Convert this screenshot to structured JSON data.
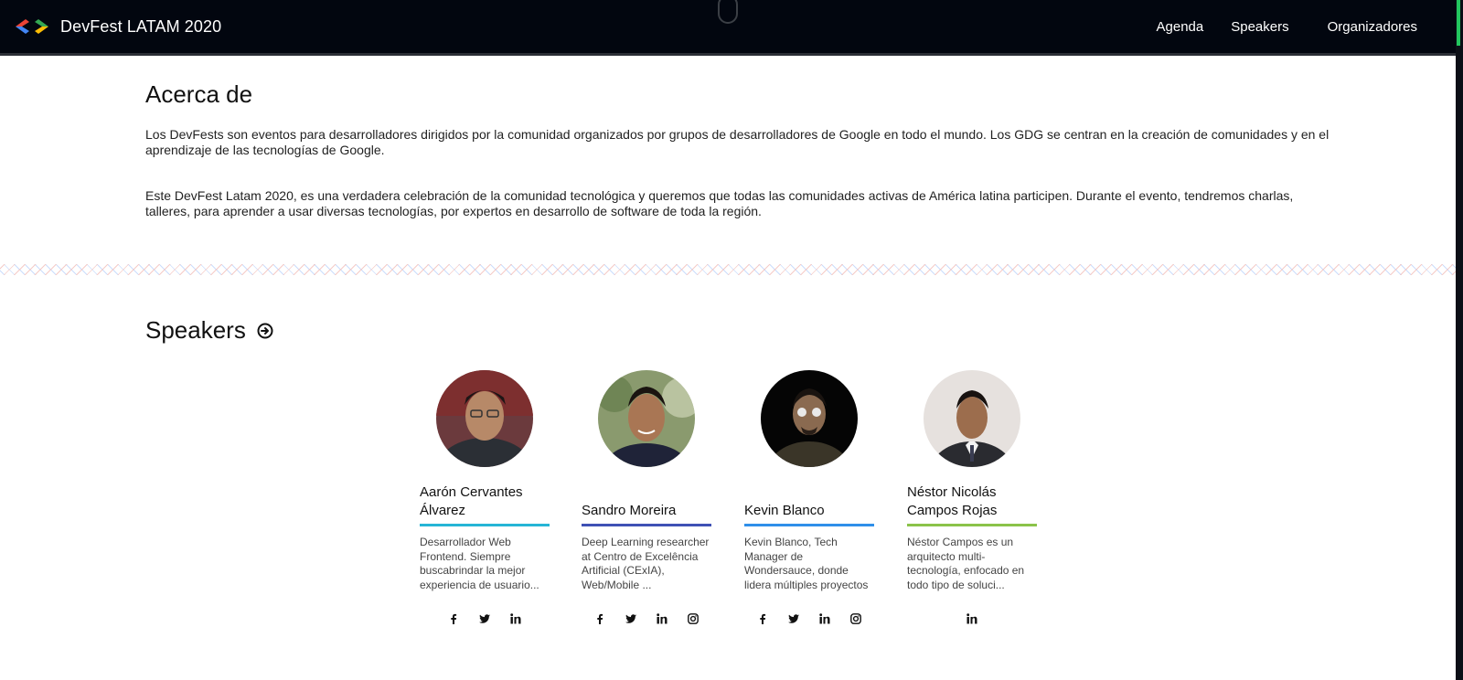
{
  "header": {
    "title": "DevFest LATAM 2020",
    "nav": [
      "Agenda",
      "Speakers",
      "Organizadores"
    ]
  },
  "about": {
    "heading": "Acerca de",
    "paragraphs": [
      "Los DevFests son eventos para desarrolladores dirigidos por la comunidad organizados por grupos de desarrolladores de Google en todo el mundo. Los GDG se centran en la creación de comunidades y en el aprendizaje de las tecnologías de Google.",
      "Este DevFest Latam 2020, es una verdadera celebración de la comunidad tecnológica y queremos que todas las comunidades activas de América latina participen. Durante el evento, tendremos charlas, talleres, para aprender a usar diversas tecnologías, por expertos en desarrollo de software de toda la región."
    ]
  },
  "speakers": {
    "heading": "Speakers",
    "items": [
      {
        "name": "Aarón Cervantes Álvarez",
        "bio": "Desarrollador Web Frontend. Siempre buscabrindar la mejor experiencia de usuario...",
        "accent": "#26b5d6",
        "socials": [
          "facebook-icon",
          "twitter-icon",
          "linkedin-icon"
        ]
      },
      {
        "name": "Sandro Moreira",
        "bio": "Deep Learning researcher at Centro de Excelência Artificial (CExIA), Web/Mobile ...",
        "accent": "#3f51b5",
        "socials": [
          "facebook-icon",
          "twitter-icon",
          "linkedin-icon",
          "instagram-icon"
        ]
      },
      {
        "name": "Kevin Blanco",
        "bio": "Kevin Blanco, Tech Manager de Wondersauce, donde lidera múltiples proyectos y eq...",
        "accent": "#2f8fe9",
        "socials": [
          "facebook-icon",
          "twitter-icon",
          "linkedin-icon",
          "instagram-icon"
        ]
      },
      {
        "name": "Néstor Nicolás Campos Rojas",
        "bio": "Néstor Campos es un arquitecto multi-tecnología, enfocado en todo tipo de soluci...",
        "accent": "#8bc34a",
        "socials": [
          "linkedin-icon"
        ]
      }
    ]
  }
}
